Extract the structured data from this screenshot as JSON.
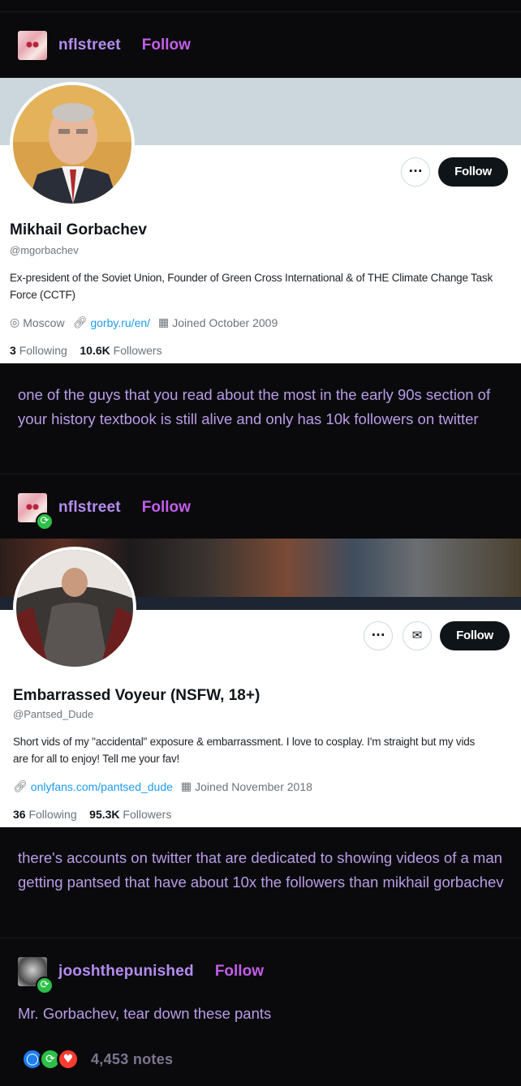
{
  "colors": {
    "accent_purple": "#b58cf0",
    "follow_link": "#c25ee8",
    "reblog_green": "#2cbf49",
    "like_red": "#ff3b30",
    "reply_blue": "#1d7ef0",
    "twitter_link": "#1d9bf0"
  },
  "post1": {
    "username": "nflstreet",
    "follow": "Follow",
    "card": {
      "name": "Mikhail Gorbachev",
      "handle": "@mgorbachev",
      "bio": "Ex-president of the Soviet Union, Founder of Green Cross International & of THE Climate Change Task Force (CCTF)",
      "location": "Moscow",
      "website": "gorby.ru/en/",
      "joined": "Joined October 2009",
      "following_count": "3",
      "following_label": "Following",
      "followers_count": "10.6K",
      "followers_label": "Followers",
      "more_icon": "more-horizontal-icon",
      "follow_button": "Follow"
    },
    "text": "one of the guys that you read about the most in the early 90s section of your history textbook is still alive and only has 10k followers on twitter"
  },
  "post2": {
    "username": "nflstreet",
    "follow": "Follow",
    "card": {
      "name": "Embarrassed Voyeur (NSFW, 18+)",
      "handle": "@Pantsed_Dude",
      "bio": "Short vids of my \"accidental\" exposure & embarrassment. I love to cosplay. I'm straight but my vids are for all to enjoy! Tell me your fav!",
      "website": "onlyfans.com/pantsed_dude",
      "joined": "Joined November 2018",
      "following_count": "36",
      "following_label": "Following",
      "followers_count": "95.3K",
      "followers_label": "Followers",
      "follow_button": "Follow"
    },
    "text": "there's accounts on twitter that are dedicated to showing videos of a man getting pantsed that have about 10x the followers than mikhail gorbachev"
  },
  "post3": {
    "username": "jooshthepunished",
    "follow": "Follow",
    "text": "Mr. Gorbachev, tear down these pants"
  },
  "notes": {
    "count": "4,453 notes"
  }
}
